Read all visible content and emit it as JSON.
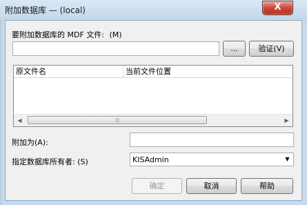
{
  "window": {
    "title": "附加数据库 — (local)",
    "close_label": "X"
  },
  "mdf": {
    "label": "要附加数据库的 MDF 文件:",
    "shortcut": "(M)",
    "value": "",
    "browse_label": "...",
    "verify_label": "验证(V)"
  },
  "files": {
    "columns": [
      "原文件名",
      "当前文件位置"
    ],
    "rows": []
  },
  "attach_as": {
    "label": "附加为(A):",
    "value": ""
  },
  "owner": {
    "label": "指定数据库所有者: (S)",
    "selected": "KISAdmin"
  },
  "buttons": {
    "ok_label": "确定",
    "cancel_label": "取消",
    "help_label": "帮助"
  }
}
